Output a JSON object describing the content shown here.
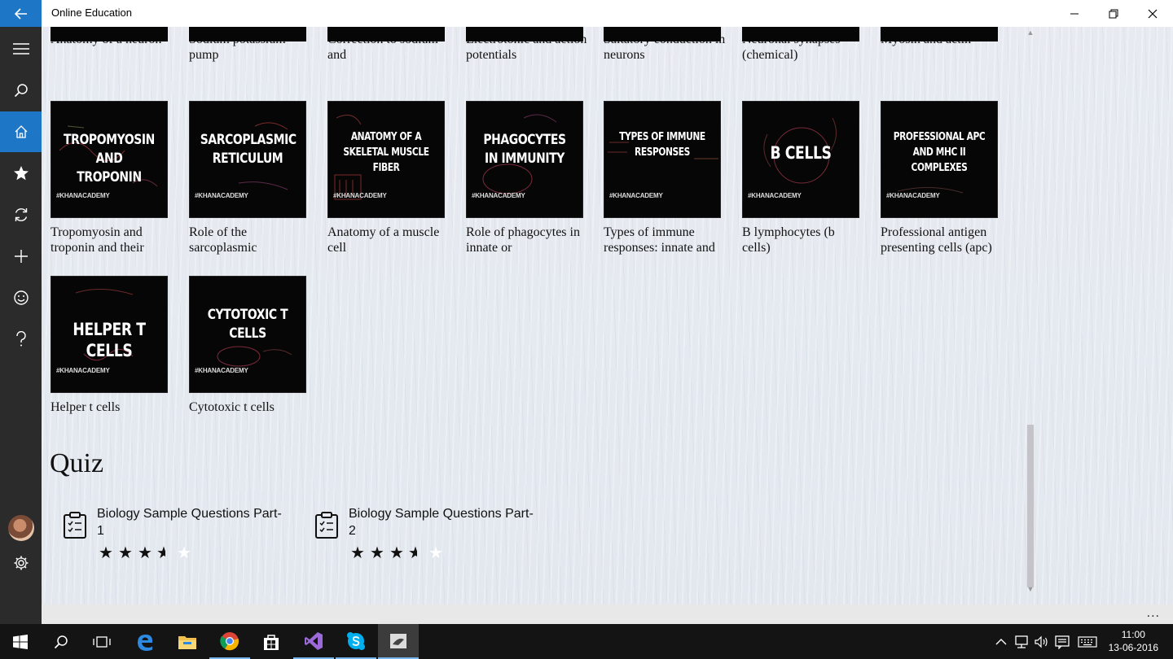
{
  "window": {
    "title": "Online Education",
    "back_icon": "back-arrow-icon",
    "minimize_icon": "minimize-icon",
    "restore_icon": "restore-icon",
    "close_icon": "close-icon"
  },
  "nav": {
    "items": [
      {
        "icon": "hamburger-menu-icon"
      },
      {
        "icon": "search-icon"
      },
      {
        "icon": "home-icon",
        "active": true
      },
      {
        "icon": "star-icon"
      },
      {
        "icon": "refresh-icon"
      },
      {
        "icon": "add-icon"
      },
      {
        "icon": "smiley-icon"
      },
      {
        "icon": "help-icon"
      }
    ],
    "settings_icon": "settings-icon"
  },
  "videos_row_top": [
    {
      "label": "Anatomy of a neuron"
    },
    {
      "label": "Sodium potassium pump"
    },
    {
      "label": "Correction to sodium and"
    },
    {
      "label": "Electrotonic and action potentials"
    },
    {
      "label": "Saltatory conduction in neurons"
    },
    {
      "label": "Neuronal synapses (chemical)"
    },
    {
      "label": "Myosin and actin"
    }
  ],
  "videos": [
    {
      "thumb_title": "TROPOMYOSIN AND TROPONIN",
      "brand": "#KHANACADEMY",
      "label": "Tropomyosin and troponin and their"
    },
    {
      "thumb_title": "SARCOPLASMIC RETICULUM",
      "brand": "#KHANACADEMY",
      "label": "Role of the sarcoplasmic"
    },
    {
      "thumb_title": "ANATOMY OF A SKELETAL MUSCLE FIBER",
      "brand": "#KHANACADEMY",
      "label": "Anatomy of a muscle cell"
    },
    {
      "thumb_title": "PHAGOCYTES IN IMMUNITY",
      "brand": "#KHANACADEMY",
      "label": "Role of phagocytes in innate or"
    },
    {
      "thumb_title": "TYPES OF IMMUNE RESPONSES",
      "brand": "#KHANACADEMY",
      "label": "Types of immune responses: innate and"
    },
    {
      "thumb_title": "B CELLS",
      "brand": "#KHANACADEMY",
      "label": "B lymphocytes (b cells)"
    },
    {
      "thumb_title": "PROFESSIONAL APC AND MHC II COMPLEXES",
      "brand": "#KHANACADEMY",
      "label": "Professional antigen presenting cells (apc)"
    },
    {
      "thumb_title": "HELPER T CELLS",
      "brand": "#KHANACADEMY",
      "label": "Helper t cells"
    },
    {
      "thumb_title": "CYTOTOXIC T CELLS",
      "brand": "#KHANACADEMY",
      "label": "Cytotoxic t cells"
    }
  ],
  "quiz": {
    "heading": "Quiz",
    "items": [
      {
        "title": "Biology Sample Questions Part-1",
        "rating": 3.5,
        "max_rating": 5,
        "icon": "clipboard-checklist-icon"
      },
      {
        "title": "Biology Sample Questions Part-2",
        "rating": 3.5,
        "max_rating": 5,
        "icon": "clipboard-checklist-icon"
      }
    ]
  },
  "more_button": "...",
  "taskbar": {
    "apps": [
      {
        "icon": "windows-start-icon"
      },
      {
        "icon": "search-icon"
      },
      {
        "icon": "task-view-icon"
      },
      {
        "icon": "edge-browser-icon"
      },
      {
        "icon": "file-explorer-icon"
      },
      {
        "icon": "chrome-icon"
      },
      {
        "icon": "store-icon"
      },
      {
        "icon": "visual-studio-icon"
      },
      {
        "icon": "skype-icon"
      },
      {
        "icon": "online-education-app-icon",
        "active": true
      }
    ],
    "tray_icons": [
      "chevron-up-icon",
      "network-icon",
      "volume-icon",
      "action-center-icon",
      "keyboard-icon"
    ],
    "time": "11:00",
    "date": "13-06-2016"
  },
  "colors": {
    "accent": "#1e77c6",
    "nav_bg": "#2b2b2b",
    "taskbar_bg": "#141414",
    "thumb_bg": "#060606"
  }
}
